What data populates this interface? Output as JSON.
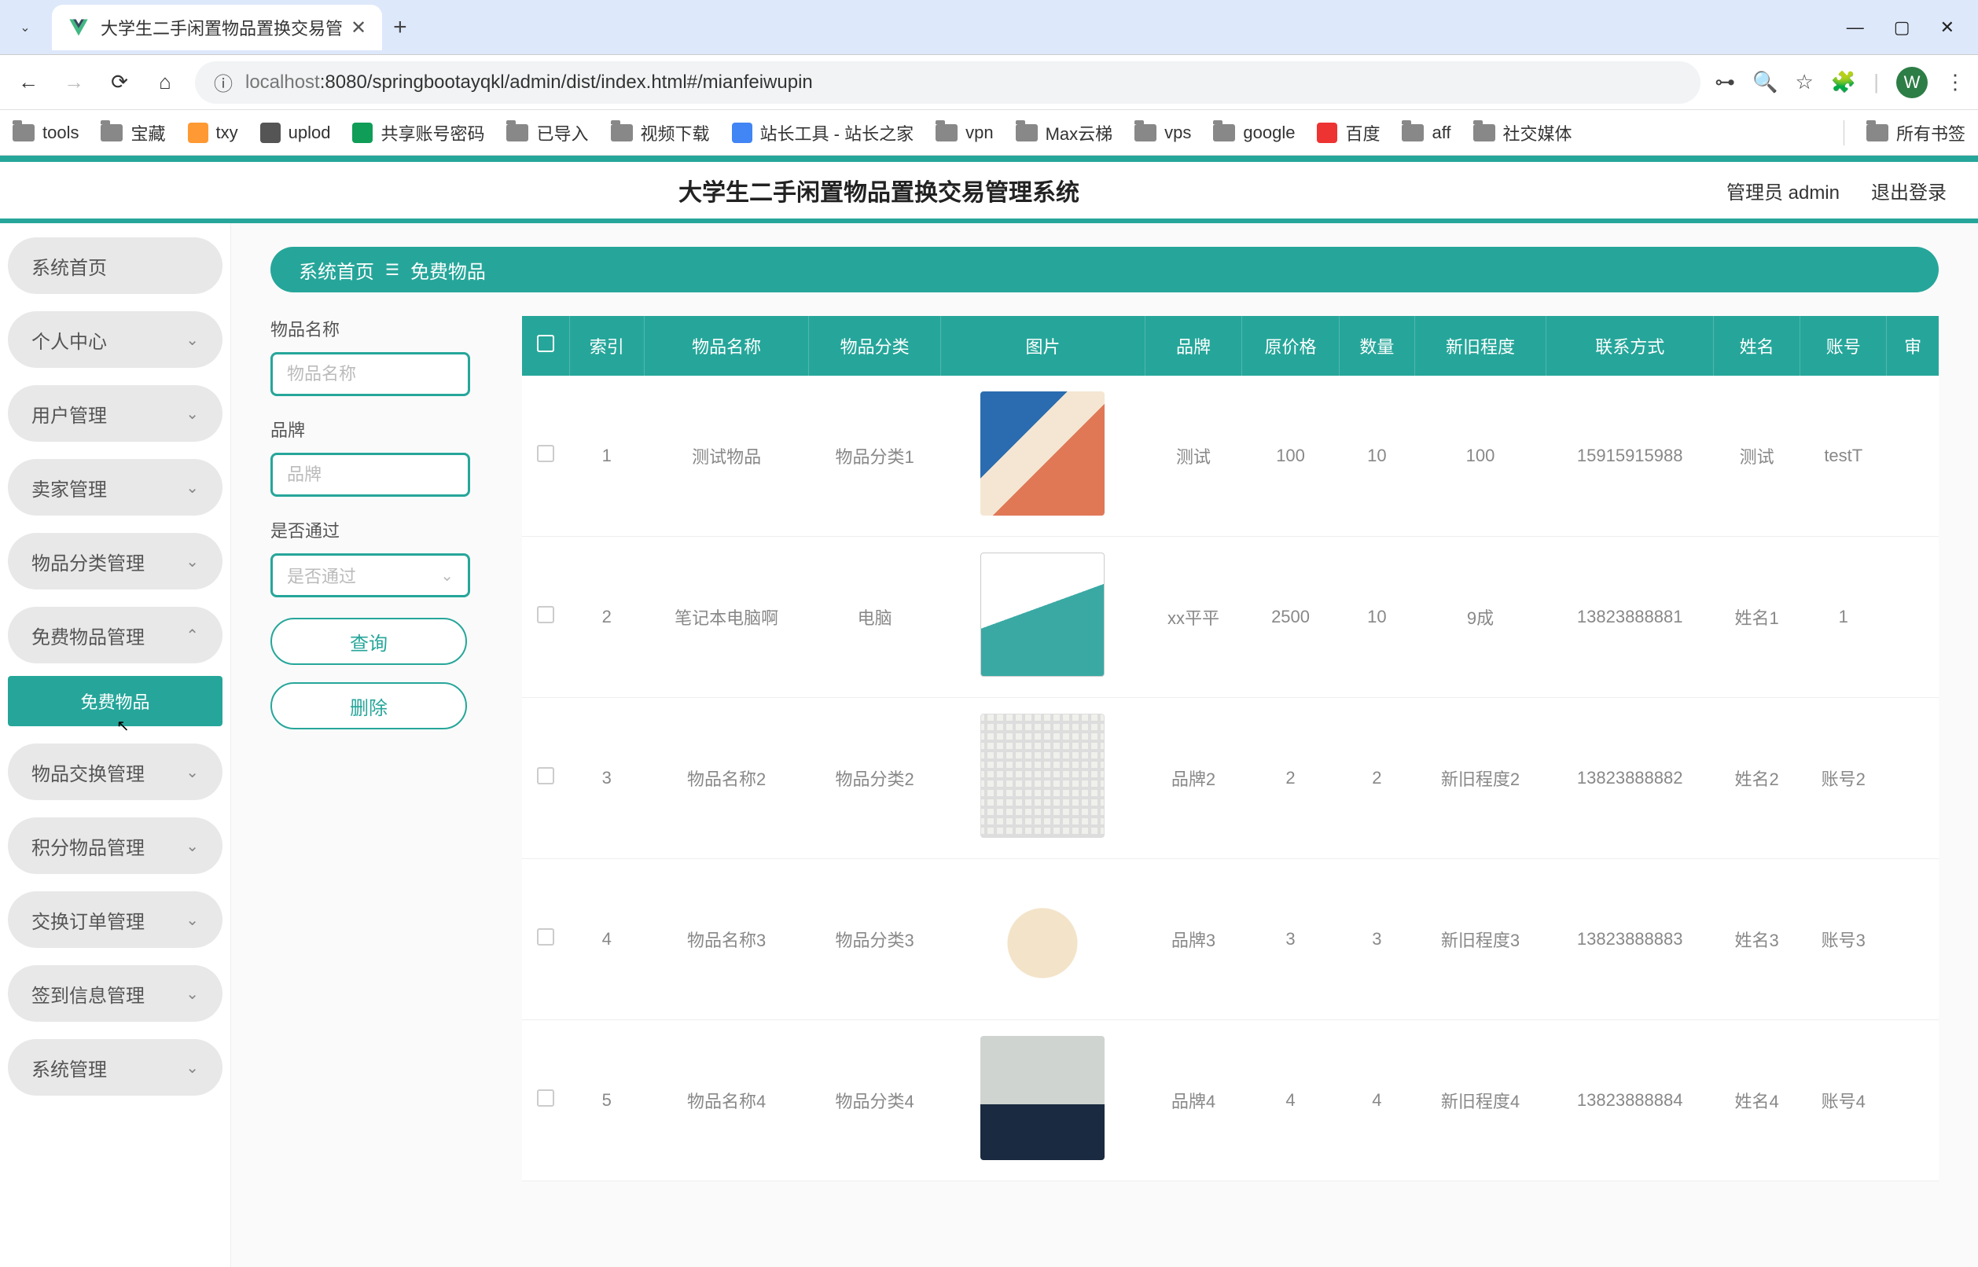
{
  "browser": {
    "tab_title": "大学生二手闲置物品置换交易管",
    "url_grey": "localhost",
    "url_rest": ":8080/springbootayqkl/admin/dist/index.html#/mianfeiwupin",
    "avatar_letter": "W"
  },
  "bookmarks": {
    "items": [
      "tools",
      "宝藏",
      "txy",
      "uplod",
      "共享账号密码",
      "已导入",
      "视频下载",
      "站长工具 - 站长之家",
      "vpn",
      "Max云梯",
      "vps",
      "google",
      "百度",
      "aff",
      "社交媒体"
    ],
    "all": "所有书签"
  },
  "header": {
    "title": "大学生二手闲置物品置换交易管理系统",
    "user": "管理员 admin",
    "logout": "退出登录"
  },
  "sidebar": {
    "items": [
      {
        "label": "系统首页",
        "expandable": false
      },
      {
        "label": "个人中心",
        "expandable": true
      },
      {
        "label": "用户管理",
        "expandable": true
      },
      {
        "label": "卖家管理",
        "expandable": true
      },
      {
        "label": "物品分类管理",
        "expandable": true
      },
      {
        "label": "免费物品管理",
        "expandable": true,
        "open": true
      },
      {
        "label": "物品交换管理",
        "expandable": true
      },
      {
        "label": "积分物品管理",
        "expandable": true
      },
      {
        "label": "交换订单管理",
        "expandable": true
      },
      {
        "label": "签到信息管理",
        "expandable": true
      },
      {
        "label": "系统管理",
        "expandable": true
      }
    ],
    "submenu": "免费物品"
  },
  "breadcrumb": {
    "home": "系统首页",
    "current": "免费物品"
  },
  "filters": {
    "name_label": "物品名称",
    "name_ph": "物品名称",
    "brand_label": "品牌",
    "brand_ph": "品牌",
    "pass_label": "是否通过",
    "pass_ph": "是否通过",
    "search_btn": "查询",
    "delete_btn": "删除"
  },
  "table": {
    "headers": [
      "",
      "索引",
      "物品名称",
      "物品分类",
      "图片",
      "品牌",
      "原价格",
      "数量",
      "新旧程度",
      "联系方式",
      "姓名",
      "账号",
      "审"
    ],
    "rows": [
      {
        "idx": "1",
        "name": "测试物品",
        "cat": "物品分类1",
        "img": "img1",
        "brand": "测试",
        "price": "100",
        "qty": "10",
        "cond": "100",
        "contact": "15915915988",
        "person": "测试",
        "acct": "testT"
      },
      {
        "idx": "2",
        "name": "笔记本电脑啊",
        "cat": "电脑",
        "img": "img2",
        "brand": "xx平平",
        "price": "2500",
        "qty": "10",
        "cond": "9成",
        "contact": "13823888881",
        "person": "姓名1",
        "acct": "1"
      },
      {
        "idx": "3",
        "name": "物品名称2",
        "cat": "物品分类2",
        "img": "img3",
        "brand": "品牌2",
        "price": "2",
        "qty": "2",
        "cond": "新旧程度2",
        "contact": "13823888882",
        "person": "姓名2",
        "acct": "账号2"
      },
      {
        "idx": "4",
        "name": "物品名称3",
        "cat": "物品分类3",
        "img": "img4",
        "brand": "品牌3",
        "price": "3",
        "qty": "3",
        "cond": "新旧程度3",
        "contact": "13823888883",
        "person": "姓名3",
        "acct": "账号3"
      },
      {
        "idx": "5",
        "name": "物品名称4",
        "cat": "物品分类4",
        "img": "img5",
        "brand": "品牌4",
        "price": "4",
        "qty": "4",
        "cond": "新旧程度4",
        "contact": "13823888884",
        "person": "姓名4",
        "acct": "账号4"
      }
    ]
  }
}
